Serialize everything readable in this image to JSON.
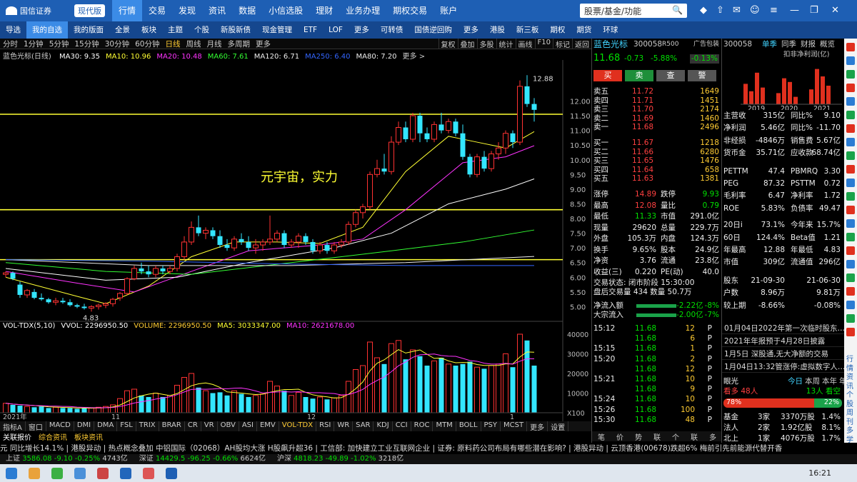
{
  "app": {
    "logo_text": "国信证券",
    "edition": "现代版"
  },
  "top_menu": [
    "行情",
    "交易",
    "发现",
    "资讯",
    "数据",
    "小信选股",
    "理财",
    "业务办理",
    "期权交易",
    "账户"
  ],
  "search": {
    "placeholder": "股票/基金/功能"
  },
  "toolbar": [
    "导选",
    "我的自选",
    "我的版面",
    "全景",
    "板块",
    "主题",
    "个股",
    "新股新债",
    "现金管理",
    "ETF",
    "LOF",
    "更多",
    "可转债",
    "国债逆回购",
    "更多",
    "港股",
    "新三板",
    "期权",
    "期货",
    "环球"
  ],
  "periods": [
    "分时",
    "1分钟",
    "5分钟",
    "15分钟",
    "30分钟",
    "60分钟",
    "日线",
    "周线",
    "月线",
    "多周期",
    "更多"
  ],
  "tools": [
    "复权",
    "叠加",
    "多股",
    "统计",
    "画线",
    "F10",
    "标记",
    "返回"
  ],
  "chart_title": "蓝色光标(日线)",
  "ma_legend": [
    {
      "t": "MA30: 9.35",
      "c": "#ffffff"
    },
    {
      "t": "MA10: 10.96",
      "c": "#ffff33"
    },
    {
      "t": "MA20: 10.48",
      "c": "#ff33ff"
    },
    {
      "t": "MA60: 7.61",
      "c": "#33ff33"
    },
    {
      "t": "MA120: 6.71",
      "c": "#eeeeee"
    },
    {
      "t": "MA250: 6.40",
      "c": "#3366ff"
    },
    {
      "t": "MA80: 7.20",
      "c": "#eeeeee"
    },
    {
      "t": "更多 >",
      "c": "#cccccc"
    }
  ],
  "annotation": "元宇宙，实力",
  "chart_data": {
    "type": "candlestick",
    "y_ticks": [
      12.0,
      11.5,
      11.0,
      10.5,
      10.0,
      9.5,
      9.0,
      8.5,
      8.0,
      7.5,
      7.0,
      6.5,
      6.0,
      5.5,
      5.0
    ],
    "ylim": [
      4.5,
      13.3
    ],
    "high_label": "12.88",
    "low_label": "4.83",
    "hlines": [
      11.55,
      8.3,
      6.6
    ],
    "candles": [
      [
        6.1,
        6.2,
        6.0,
        6.15
      ],
      [
        6.15,
        6.2,
        5.9,
        5.95
      ],
      [
        5.75,
        5.85,
        5.3,
        5.4
      ],
      [
        5.4,
        5.6,
        5.3,
        5.55
      ],
      [
        5.5,
        5.6,
        5.25,
        5.3
      ],
      [
        5.3,
        5.45,
        5.2,
        5.25
      ],
      [
        5.25,
        5.3,
        5.1,
        5.15
      ],
      [
        5.15,
        5.3,
        5.05,
        5.2
      ],
      [
        5.2,
        5.3,
        5.1,
        5.15
      ],
      [
        5.15,
        5.25,
        5.0,
        5.05
      ],
      [
        5.05,
        5.1,
        4.95,
        5.0
      ],
      [
        5.0,
        5.1,
        4.9,
        4.95
      ],
      [
        4.95,
        5.05,
        4.83,
        5.0
      ],
      [
        5.0,
        5.1,
        4.9,
        5.05
      ],
      [
        5.05,
        5.15,
        4.95,
        5.1
      ],
      [
        5.1,
        5.3,
        5.0,
        5.25
      ],
      [
        5.3,
        5.5,
        5.2,
        5.45
      ],
      [
        5.45,
        6.0,
        5.4,
        5.95
      ],
      [
        5.95,
        6.4,
        5.9,
        6.3
      ],
      [
        6.3,
        6.5,
        6.1,
        6.2
      ],
      [
        6.2,
        6.4,
        6.0,
        6.1
      ],
      [
        6.1,
        6.4,
        6.0,
        6.3
      ],
      [
        6.3,
        6.4,
        6.1,
        6.2
      ],
      [
        6.2,
        6.4,
        6.1,
        6.3
      ],
      [
        6.3,
        6.8,
        6.2,
        6.7
      ],
      [
        6.7,
        7.4,
        6.6,
        7.2
      ],
      [
        7.2,
        7.9,
        7.1,
        7.7
      ],
      [
        7.7,
        8.1,
        7.4,
        7.5
      ],
      [
        7.5,
        7.7,
        7.3,
        7.6
      ],
      [
        7.6,
        7.7,
        7.3,
        7.4
      ],
      [
        7.4,
        7.6,
        7.0,
        7.1
      ],
      [
        7.1,
        7.3,
        6.9,
        7.0
      ],
      [
        7.0,
        7.4,
        6.9,
        7.3
      ],
      [
        7.3,
        7.5,
        7.1,
        7.2
      ],
      [
        7.2,
        7.4,
        6.9,
        7.0
      ],
      [
        7.0,
        7.3,
        6.8,
        7.1
      ],
      [
        7.1,
        7.3,
        6.9,
        7.2
      ],
      [
        7.2,
        8.1,
        7.1,
        7.3
      ],
      [
        7.3,
        7.6,
        7.2,
        7.5
      ],
      [
        7.5,
        7.6,
        7.0,
        7.1
      ],
      [
        7.1,
        7.3,
        7.0,
        7.2
      ],
      [
        7.2,
        7.5,
        7.0,
        7.4
      ],
      [
        7.4,
        7.5,
        7.1,
        7.2
      ],
      [
        7.2,
        7.3,
        6.8,
        6.9
      ],
      [
        6.9,
        7.2,
        6.8,
        7.1
      ],
      [
        7.1,
        7.2,
        6.8,
        6.9
      ],
      [
        6.9,
        7.2,
        6.8,
        7.1
      ],
      [
        7.1,
        7.3,
        7.0,
        7.2
      ],
      [
        7.2,
        7.9,
        7.1,
        7.8
      ],
      [
        7.8,
        8.3,
        7.7,
        8.2
      ],
      [
        8.2,
        8.5,
        8.0,
        8.4
      ],
      [
        8.4,
        9.6,
        8.3,
        9.5
      ],
      [
        9.5,
        10.0,
        9.4,
        9.7
      ],
      [
        9.7,
        10.2,
        9.5,
        9.6
      ],
      [
        9.6,
        10.8,
        9.5,
        10.6
      ],
      [
        10.6,
        11.3,
        10.5,
        11.1
      ],
      [
        11.1,
        11.3,
        10.6,
        10.7
      ],
      [
        10.7,
        11.6,
        10.6,
        11.5
      ],
      [
        11.5,
        11.6,
        10.6,
        10.9
      ],
      [
        10.9,
        11.1,
        10.6,
        10.7
      ],
      [
        10.7,
        11.3,
        10.6,
        11.2
      ],
      [
        11.2,
        11.6,
        10.9,
        11.0
      ],
      [
        11.0,
        11.4,
        10.9,
        11.3
      ],
      [
        11.3,
        11.4,
        10.8,
        10.9
      ],
      [
        10.9,
        11.2,
        10.0,
        10.1
      ],
      [
        10.1,
        10.2,
        9.4,
        9.5
      ],
      [
        9.5,
        10.2,
        9.4,
        10.1
      ],
      [
        10.1,
        10.3,
        9.6,
        9.7
      ],
      [
        9.7,
        10.3,
        9.6,
        10.2
      ],
      [
        10.2,
        10.6,
        10.0,
        10.4
      ],
      [
        10.4,
        11.0,
        10.2,
        10.9
      ],
      [
        10.9,
        11.0,
        10.4,
        10.6
      ],
      [
        10.6,
        12.7,
        10.5,
        12.5
      ],
      [
        12.5,
        12.88,
        11.8,
        11.9
      ],
      [
        11.9,
        12.1,
        11.3,
        11.7
      ]
    ],
    "ma_lines": [
      {
        "name": "MA10",
        "color": "#ffff33",
        "points": [
          [
            0,
            6.0
          ],
          [
            10,
            5.35
          ],
          [
            14,
            5.1
          ],
          [
            20,
            5.7
          ],
          [
            26,
            6.7
          ],
          [
            32,
            7.2
          ],
          [
            38,
            7.2
          ],
          [
            44,
            7.15
          ],
          [
            50,
            7.7
          ],
          [
            56,
            9.6
          ],
          [
            62,
            10.8
          ],
          [
            66,
            10.6
          ],
          [
            70,
            10.4
          ],
          [
            74,
            10.96
          ]
        ]
      },
      {
        "name": "MA20",
        "color": "#ff33ff",
        "points": [
          [
            0,
            6.2
          ],
          [
            10,
            5.8
          ],
          [
            18,
            5.5
          ],
          [
            26,
            6.2
          ],
          [
            34,
            6.9
          ],
          [
            44,
            7.1
          ],
          [
            50,
            7.3
          ],
          [
            56,
            8.3
          ],
          [
            64,
            9.9
          ],
          [
            70,
            10.1
          ],
          [
            74,
            10.48
          ]
        ]
      },
      {
        "name": "MA30",
        "color": "#ffffff",
        "points": [
          [
            0,
            6.3
          ],
          [
            14,
            5.9
          ],
          [
            24,
            6.0
          ],
          [
            34,
            6.5
          ],
          [
            46,
            7.0
          ],
          [
            54,
            7.5
          ],
          [
            62,
            8.5
          ],
          [
            70,
            9.0
          ],
          [
            74,
            9.35
          ]
        ]
      },
      {
        "name": "MA60",
        "color": "#33ff33",
        "points": [
          [
            0,
            6.5
          ],
          [
            14,
            6.2
          ],
          [
            26,
            6.1
          ],
          [
            40,
            6.5
          ],
          [
            54,
            6.9
          ],
          [
            64,
            7.2
          ],
          [
            74,
            7.61
          ]
        ]
      },
      {
        "name": "MA120",
        "color": "#eeeeee",
        "points": [
          [
            0,
            6.6
          ],
          [
            20,
            6.4
          ],
          [
            40,
            6.4
          ],
          [
            56,
            6.5
          ],
          [
            74,
            6.71
          ]
        ]
      },
      {
        "name": "MA250",
        "color": "#3366ff",
        "points": [
          [
            0,
            6.6
          ],
          [
            20,
            6.55
          ],
          [
            40,
            6.45
          ],
          [
            56,
            6.4
          ],
          [
            74,
            6.4
          ]
        ]
      }
    ],
    "vol_ticks": [
      "40000",
      "30000",
      "20000",
      "10000",
      "X100"
    ],
    "date_labels": [
      "2021年",
      "11",
      "12",
      "1"
    ],
    "volumes": [
      0.12,
      0.1,
      0.09,
      0.08,
      0.07,
      0.08,
      0.06,
      0.07,
      0.06,
      0.06,
      0.05,
      0.06,
      0.06,
      0.07,
      0.08,
      0.1,
      0.18,
      0.28,
      0.3,
      0.22,
      0.2,
      0.25,
      0.2,
      0.22,
      0.35,
      0.45,
      0.5,
      0.32,
      0.28,
      0.25,
      0.26,
      0.22,
      0.28,
      0.24,
      0.2,
      0.22,
      0.24,
      0.4,
      0.34,
      0.28,
      0.22,
      0.26,
      0.2,
      0.18,
      0.2,
      0.17,
      0.19,
      0.22,
      0.4,
      0.55,
      0.6,
      0.9,
      0.7,
      0.62,
      0.88,
      0.92,
      0.68,
      0.8,
      0.72,
      0.6,
      0.66,
      0.7,
      0.62,
      0.6,
      0.62,
      0.65,
      0.58,
      0.56,
      0.6,
      0.62,
      0.75,
      0.58,
      1.0,
      0.92,
      0.6
    ],
    "volume_legend": [
      {
        "t": "VOL-TDX(5,10)",
        "c": "#ffffff"
      },
      {
        "t": "VVOL: 2296950.50",
        "c": "#ffffff"
      },
      {
        "t": "VOLUME: 2296950.50",
        "c": "#ffcc33"
      },
      {
        "t": "MA5: 3033347.00",
        "c": "#ffff33"
      },
      {
        "t": "MA10: 2621678.00",
        "c": "#ff33ff"
      }
    ]
  },
  "indicator_tabs": [
    "指标A",
    "窗口",
    "MACD",
    "DMI",
    "DMA",
    "FSL",
    "TRIX",
    "BRAR",
    "CR",
    "VR",
    "OBV",
    "ASI",
    "EMV",
    "VOL-TDX",
    "RSI",
    "WR",
    "SAR",
    "KDJ",
    "CCI",
    "ROC",
    "MTM",
    "BOLL",
    "PSY",
    "MCST",
    "更多",
    "设置"
  ],
  "sub_tabs": [
    "关联报价",
    "综合资讯",
    "板块资讯"
  ],
  "quote": {
    "name": "蓝色光标",
    "code": "300058",
    "r": "R500",
    "ad": "广告包装",
    "price": "11.68",
    "change": "-0.73",
    "pct": "-5.88%",
    "small_pct": "-0.13%",
    "buttons": [
      "买",
      "卖",
      "查",
      "警"
    ],
    "asks": [
      [
        "卖五",
        "11.72",
        "1649"
      ],
      [
        "卖四",
        "11.71",
        "1451"
      ],
      [
        "卖三",
        "11.70",
        "2174"
      ],
      [
        "卖二",
        "11.69",
        "1460"
      ],
      [
        "卖一",
        "11.68",
        "2496"
      ]
    ],
    "bids": [
      [
        "买一",
        "11.67",
        "1218"
      ],
      [
        "买二",
        "11.66",
        "6280"
      ],
      [
        "买三",
        "11.65",
        "1476"
      ],
      [
        "买四",
        "11.64",
        "658"
      ],
      [
        "买五",
        "11.63",
        "1381"
      ]
    ],
    "stats": [
      [
        "涨停",
        "14.89",
        "跌停",
        "9.93"
      ],
      [
        "最高",
        "12.08",
        "量比",
        "0.79"
      ],
      [
        "最低",
        "11.33",
        "市值",
        "291.0亿"
      ],
      [
        "现量",
        "29620",
        "总量",
        "229.7万"
      ],
      [
        "外盘",
        "105.3万",
        "内盘",
        "124.3万"
      ],
      [
        "换手",
        "9.65%",
        "股本",
        "24.9亿"
      ],
      [
        "净资",
        "3.76",
        "流通",
        "23.8亿"
      ],
      [
        "收益(三)",
        "0.220",
        "PE(动)",
        "40.0"
      ]
    ],
    "status": "交易状态: 闭市阶段 15:30:00",
    "after": "盘后交易量 434 数量 50.7万",
    "flows": [
      [
        "净流入额",
        "-2.22亿",
        "-8%"
      ],
      [
        "大宗流入",
        "-2.00亿",
        "-7%"
      ]
    ],
    "ticks": [
      [
        "15:12",
        "11.68",
        "12",
        "P"
      ],
      [
        "",
        "11.68",
        "6",
        "P"
      ],
      [
        "15:15",
        "11.68",
        "1",
        "P"
      ],
      [
        "15:20",
        "11.68",
        "2",
        "P"
      ],
      [
        "",
        "11.68",
        "12",
        "P"
      ],
      [
        "15:21",
        "11.68",
        "10",
        "P"
      ],
      [
        "",
        "11.68",
        "9",
        "P"
      ],
      [
        "15:24",
        "11.68",
        "10",
        "P"
      ],
      [
        "15:26",
        "11.68",
        "100",
        "P"
      ],
      [
        "15:30",
        "11.68",
        "48",
        "P"
      ]
    ],
    "bottom_tabs": [
      "笔",
      "价",
      "势",
      "联",
      "个",
      "联",
      "多"
    ]
  },
  "f10": {
    "code": "300058",
    "tabs": [
      "单季",
      "同季",
      "财报",
      "概览"
    ],
    "chart_title": "扣非净利润(亿)",
    "years": [
      "2019",
      "2020",
      "2021"
    ],
    "bars": [
      0.55,
      0.35,
      0.85,
      0.45,
      0.3,
      0.7,
      0.6,
      0.2,
      0.4,
      0.95,
      0.75,
      0.5
    ],
    "rows": [
      [
        "主营收",
        "315亿",
        "同比%",
        "9.10"
      ],
      [
        "净利润",
        "5.46亿",
        "同比%",
        "-11.70"
      ],
      [
        "非经损",
        "-4846万",
        "销售费",
        "5.67亿"
      ],
      [
        "货币金",
        "35.71亿",
        "应收款",
        "68.74亿"
      ],
      [
        "PETTM",
        "47.4",
        "PBMRQ",
        "3.30"
      ],
      [
        "PEG",
        "87.32",
        "PSTTM",
        "0.72"
      ],
      [
        "毛利率",
        "6.47",
        "净利率",
        "1.72"
      ],
      [
        "ROE",
        "5.83%",
        "负债率",
        "49.47"
      ],
      [
        "20日i",
        "73.1%",
        "今年来",
        "15.7%"
      ],
      [
        "60日",
        "124.4%",
        "Beta值",
        "1.21"
      ],
      [
        "年最高",
        "12.88",
        "年最低",
        "4.83"
      ],
      [
        "市值",
        "309亿",
        "流通值",
        "296亿"
      ],
      [
        "股东",
        "21-09-30",
        "",
        "21-06-30"
      ],
      [
        "户数",
        "8.96万",
        "",
        "9.81万"
      ],
      [
        "较上期",
        "-8.66%",
        "",
        "-0.08%"
      ]
    ],
    "news": [
      "01月04日2022年第一次临时股东…",
      "2021年年报预于4月28日披露",
      "1月5日 深股通,无大净额的交易",
      "1月04日13:32管涨停:虚拟数字人…"
    ],
    "ratings": {
      "label": "眼光",
      "tabs": [
        "今日",
        "本周",
        "本年",
        "年"
      ],
      "bull": "看多 48人",
      "bear": "13人 看空",
      "pct_up": "78%",
      "pct_down": "22%"
    },
    "holders": [
      [
        "基金",
        "3家",
        "3370万股",
        "1.4%"
      ],
      [
        "法人",
        "2家",
        "1.92亿股",
        "8.1%"
      ],
      [
        "北上",
        "1家",
        "4076万股",
        "1.7%"
      ]
    ]
  },
  "right_bar": [
    "行",
    "情",
    "资",
    "讯",
    "个",
    "股",
    "周",
    "刊",
    "多",
    "学"
  ],
  "ticker": "元 同比增长14.1% | 港股异动 | 热点概念叠加 中铝国际（02068）AH股均大涨 H股飙升超36 | 工信部: 加快建立工业互联网企业 | 证券: 原料药公司布局有哪些潜在影响? | 港股异动 | 云顶香港(00678)跌超6% 梅前引先前能源代替开香",
  "indices": [
    {
      "n": "上证",
      "v": "3586.08",
      "c": "-9.10",
      "p": "-0.25%",
      "a": "4743亿"
    },
    {
      "n": "深证",
      "v": "14429.5",
      "c": "-96.25",
      "p": "-0.66%",
      "a": "6624亿"
    },
    {
      "n": "沪深",
      "v": "4818.23",
      "c": "-49.89",
      "p": "-1.02%",
      "a": "3218亿"
    }
  ],
  "clock": "16:21"
}
